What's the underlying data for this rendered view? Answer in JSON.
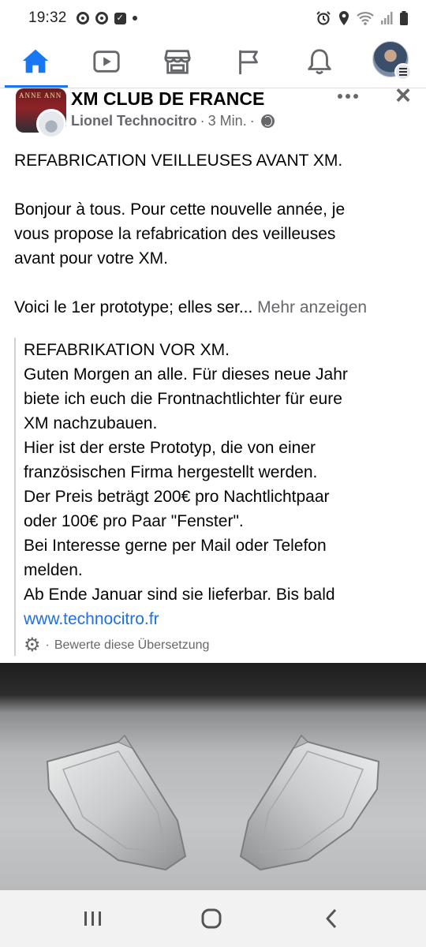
{
  "status_bar": {
    "time": "19:32",
    "left_icons": [
      "camera-notification-icon",
      "camera-notification-icon",
      "checkbox-notification-icon",
      "dot-icon"
    ],
    "right_icons": [
      "alarm-icon",
      "location-icon",
      "wifi-icon",
      "signal-icon",
      "battery-icon"
    ]
  },
  "nav": {
    "items": [
      {
        "name": "home",
        "icon": "home-icon",
        "active": true
      },
      {
        "name": "watch",
        "icon": "video-icon",
        "active": false
      },
      {
        "name": "marketplace",
        "icon": "store-icon",
        "active": false
      },
      {
        "name": "pages",
        "icon": "flag-icon",
        "active": false
      },
      {
        "name": "notifications",
        "icon": "bell-icon",
        "active": false
      },
      {
        "name": "menu",
        "icon": "profile-avatar",
        "active": false
      }
    ],
    "accent_color": "#1877f2"
  },
  "post": {
    "group_thumb_text": "ANNE ANN",
    "group_name": "XM CLUB DE FRANCE",
    "author": "Lionel Technocitro",
    "separator": "·",
    "time": "3 Min.",
    "separator2": "·",
    "body_lines": [
      "REFABRICATION VEILLEUSES AVANT XM.",
      "",
      "Bonjour à tous. Pour cette nouvelle année, je",
      "vous propose la refabrication des veilleuses",
      "avant pour votre XM.",
      "",
      "Voici le 1er prototype; elles ser..."
    ],
    "see_more": "Mehr anzeigen"
  },
  "translation": {
    "lines": [
      "REFABRIKATION VOR XM.",
      "Guten Morgen an alle. Für dieses neue Jahr",
      "biete ich euch die Frontnachtlichter für eure",
      "XM nachzubauen.",
      "Hier ist der erste Prototyp, die von einer",
      "französischen Firma hergestellt werden.",
      "Der Preis beträgt 200€ pro Nachtlichtpaar",
      "oder 100€ pro Paar \"Fenster\".",
      "Bei Interesse gerne per Mail oder Telefon",
      "melden.",
      "Ab Ende Januar sind sie lieferbar. Bis bald"
    ],
    "link": "www.technocitro.fr",
    "rate_prefix": "·",
    "rate_label": "Bewerte diese Übersetzung"
  },
  "photo": {
    "subject": "two clear front indicator lamps on grey background"
  }
}
